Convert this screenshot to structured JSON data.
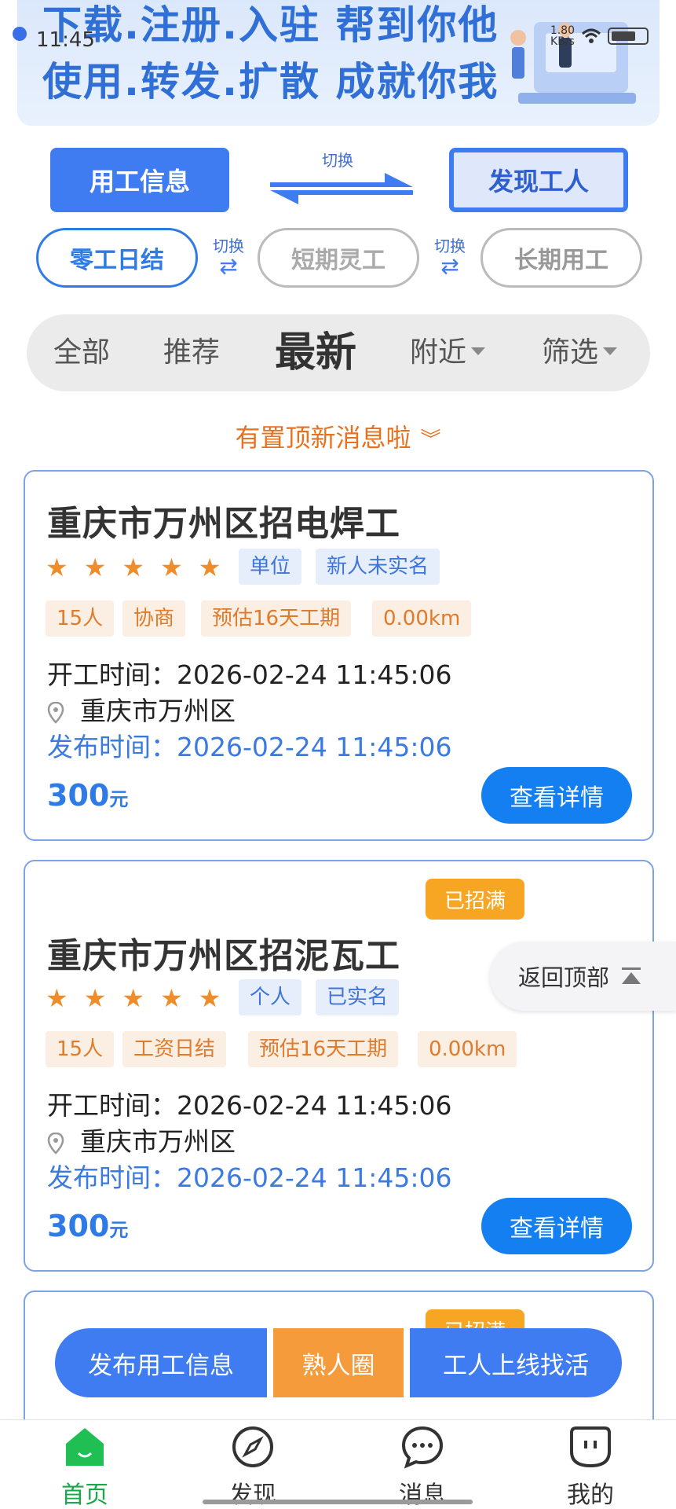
{
  "status": {
    "time": "11:45",
    "speed_value": "1.80",
    "speed_unit": "KB/s"
  },
  "banner": {
    "line1": "下载.注册.入驻  帮到你他",
    "line2": "使用.转发.扩散  成就你我"
  },
  "mode": {
    "left_label": "用工信息",
    "switch_label": "切换",
    "right_label": "发现工人"
  },
  "work_types": {
    "items": [
      "零工日结",
      "短期灵工",
      "长期用工"
    ],
    "switch_label": "切换",
    "swap_icon": "⇄"
  },
  "filters": {
    "tabs": [
      "全部",
      "推荐",
      "最新",
      "附近",
      "筛选"
    ],
    "active": "最新"
  },
  "pinned_notice": {
    "text": "有置顶新消息啦",
    "icon": "chevron-double-down-icon",
    "glyph": "︾"
  },
  "jobs": [
    {
      "title": "重庆市万州区招电焊工",
      "rating": 5,
      "star_glyph": "★",
      "tags_blue": [
        "单位",
        "新人未实名"
      ],
      "tags_orange": [
        "15人",
        "协商",
        "预估16天工期",
        "0.00km"
      ],
      "start_label": "开工时间：",
      "start_time": "2026-02-24 11:45:06",
      "location": "重庆市万州区",
      "publish_label": "发布时间：",
      "publish_time": "2026-02-24 11:45:06",
      "price_value": "300",
      "price_unit": "元",
      "detail_button": "查看详情"
    },
    {
      "title": "重庆市万州区招泥瓦工",
      "badge": "已招满",
      "rating": 5,
      "star_glyph": "★",
      "tags_blue": [
        "个人",
        "已实名"
      ],
      "tags_orange": [
        "15人",
        "工资日结",
        "预估16天工期",
        "0.00km"
      ],
      "start_label": "开工时间：",
      "start_time": "2026-02-24 11:45:06",
      "location": "重庆市万州区",
      "publish_label": "发布时间：",
      "publish_time": "2026-02-24 11:45:06",
      "price_value": "300",
      "price_unit": "元",
      "detail_button": "查看详情"
    }
  ],
  "back_to_top": "返回顶部",
  "fab": {
    "post_job": "发布用工信息",
    "acquaintance": "熟人圈",
    "worker_online": "工人上线找活"
  },
  "nav": [
    {
      "label": "首页",
      "icon": "home-icon",
      "active": true
    },
    {
      "label": "发现",
      "icon": "compass-icon",
      "active": false
    },
    {
      "label": "消息",
      "icon": "chat-bubble-icon",
      "active": false
    },
    {
      "label": "我的",
      "icon": "profile-icon",
      "active": false
    }
  ],
  "colors": {
    "primary": "#3f7cf2",
    "accent_orange": "#f59b3c",
    "active_green": "#19a84a",
    "badge_full": "#f7a623"
  }
}
